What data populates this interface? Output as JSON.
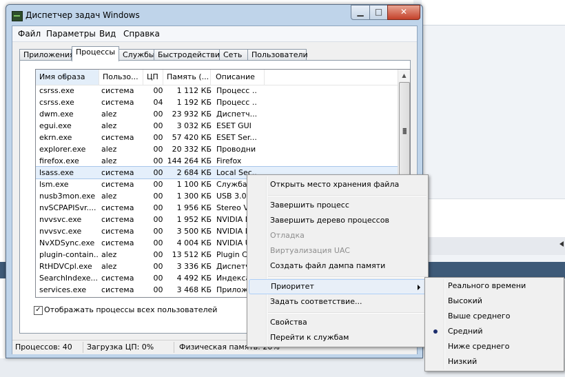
{
  "window": {
    "title": "Диспетчер задач Windows",
    "controls": {
      "minimize": "▁",
      "maximize": "□",
      "close": "✕"
    }
  },
  "menu": [
    "Файл",
    "Параметры",
    "Вид",
    "Справка"
  ],
  "tabs": [
    "Приложения",
    "Процессы",
    "Службы",
    "Быстродействие",
    "Сеть",
    "Пользователи"
  ],
  "active_tab": "Процессы",
  "columns": [
    "Имя образа",
    "Пользо...",
    "ЦП",
    "Память (...",
    "Описание"
  ],
  "processes": [
    {
      "name": "csrss.exe",
      "user": "система",
      "cpu": "00",
      "mem": "1 112 КБ",
      "desc": "Процесс ..."
    },
    {
      "name": "csrss.exe",
      "user": "система",
      "cpu": "04",
      "mem": "1 192 КБ",
      "desc": "Процесс ..."
    },
    {
      "name": "dwm.exe",
      "user": "alez",
      "cpu": "00",
      "mem": "23 932 КБ",
      "desc": "Диспетч..."
    },
    {
      "name": "egui.exe",
      "user": "alez",
      "cpu": "00",
      "mem": "3 032 КБ",
      "desc": "ESET GUI"
    },
    {
      "name": "ekrn.exe",
      "user": "система",
      "cpu": "00",
      "mem": "57 420 КБ",
      "desc": "ESET Ser..."
    },
    {
      "name": "explorer.exe",
      "user": "alez",
      "cpu": "00",
      "mem": "20 332 КБ",
      "desc": "Проводник"
    },
    {
      "name": "firefox.exe",
      "user": "alez",
      "cpu": "00",
      "mem": "144 264 КБ",
      "desc": "Firefox"
    },
    {
      "name": "lsass.exe",
      "user": "система",
      "cpu": "00",
      "mem": "2 684 КБ",
      "desc": "Local Sec...",
      "selected": true
    },
    {
      "name": "lsm.exe",
      "user": "система",
      "cpu": "00",
      "mem": "1 100 КБ",
      "desc": "Служба ..."
    },
    {
      "name": "nusb3mon.exe",
      "user": "alez",
      "cpu": "00",
      "mem": "1 300 КБ",
      "desc": "USB 3.0 ..."
    },
    {
      "name": "nvSCPAPISvr....",
      "user": "система",
      "cpu": "00",
      "mem": "1 956 КБ",
      "desc": "Stereo Vis..."
    },
    {
      "name": "nvvsvc.exe",
      "user": "система",
      "cpu": "00",
      "mem": "1 952 КБ",
      "desc": "NVIDIA D..."
    },
    {
      "name": "nvvsvc.exe",
      "user": "система",
      "cpu": "00",
      "mem": "3 500 КБ",
      "desc": "NVIDIA D..."
    },
    {
      "name": "NvXDSync.exe",
      "user": "система",
      "cpu": "00",
      "mem": "4 004 КБ",
      "desc": "NVIDIA U..."
    },
    {
      "name": "plugin-contain...",
      "user": "alez",
      "cpu": "00",
      "mem": "13 512 КБ",
      "desc": "Plugin Co..."
    },
    {
      "name": "RtHDVCpl.exe",
      "user": "alez",
      "cpu": "00",
      "mem": "3 336 КБ",
      "desc": "Диспетч..."
    },
    {
      "name": "SearchIndexe...",
      "user": "система",
      "cpu": "00",
      "mem": "4 492 КБ",
      "desc": "Индекса..."
    },
    {
      "name": "services.exe",
      "user": "система",
      "cpu": "00",
      "mem": "3 468 КБ",
      "desc": "Приложе..."
    }
  ],
  "show_all_users": {
    "label": "Отображать процессы всех пользователей",
    "checked": true,
    "mark": "✓"
  },
  "status": {
    "processes": "Процессов: 40",
    "cpu": "Загрузка ЦП: 0%",
    "memory": "Физическая память: 20%"
  },
  "context_menu": [
    {
      "label": "Открыть место хранения файла"
    },
    {
      "label": "Завершить процесс"
    },
    {
      "label": "Завершить дерево процессов"
    },
    {
      "label": "Отладка",
      "disabled": true
    },
    {
      "label": "Виртуализация UAC",
      "disabled": true
    },
    {
      "label": "Создать файл дампа памяти"
    },
    {
      "label": "Приоритет",
      "submenu": true,
      "highlighted": true
    },
    {
      "label": "Задать соответствие..."
    },
    {
      "label": "Свойства"
    },
    {
      "label": "Перейти к службам"
    }
  ],
  "priority_submenu": [
    {
      "label": "Реального времени"
    },
    {
      "label": "Высокий"
    },
    {
      "label": "Выше среднего"
    },
    {
      "label": "Средний",
      "checked": true
    },
    {
      "label": "Ниже среднего"
    },
    {
      "label": "Низкий"
    }
  ],
  "colors": {
    "selection": "#e4effb",
    "window_frame": "#bfd4ea",
    "close_button": "#c4412a"
  }
}
